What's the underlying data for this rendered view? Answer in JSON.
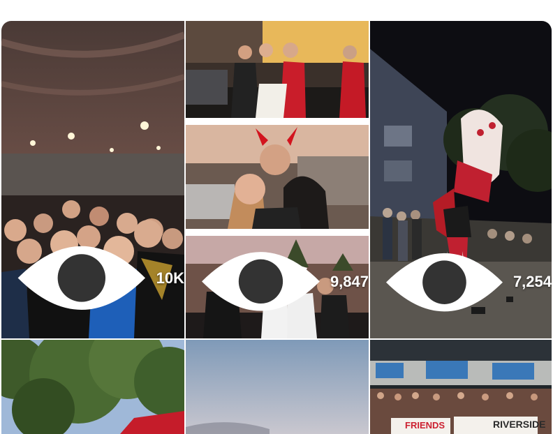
{
  "grid": {
    "tiles": [
      {
        "id": "crowd-room",
        "views": "10K"
      },
      {
        "id": "devil-horns-night",
        "views": ""
      },
      {
        "id": "devil-horns-selfie",
        "views": ""
      },
      {
        "id": "bunny-ears-group",
        "views": "9,847"
      },
      {
        "id": "lion-dance",
        "views": "7,254"
      },
      {
        "id": "trees",
        "views": ""
      },
      {
        "id": "sunset-sky",
        "views": ""
      },
      {
        "id": "auditorium-banner",
        "views": ""
      }
    ]
  },
  "auditorium": {
    "banner_left": "FRIENDS",
    "banner_right": "RIVERSIDE"
  },
  "icons": {
    "views": "eye-icon"
  }
}
